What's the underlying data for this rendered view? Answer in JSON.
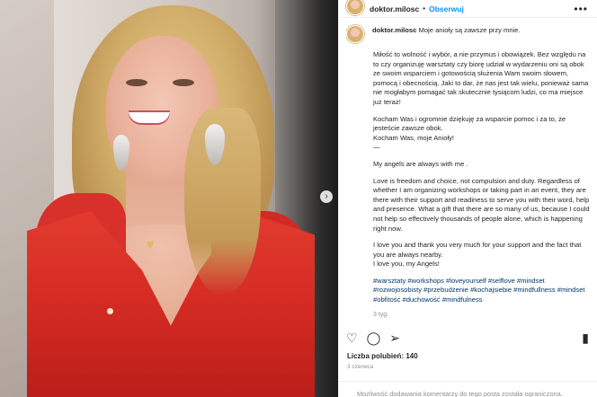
{
  "header": {
    "username": "doktor.milosc",
    "separator": "•",
    "follow_label": "Obserwuj",
    "more_icon": "more-horizontal-icon"
  },
  "caption": {
    "username": "doktor.milosc",
    "first_line": "Moje anioły są zawsze przy mnie.",
    "paragraph_pl_1": "Miłość to wolność i wybór, a nie przymus i obowiązek. Bez względu na to czy organizuję warsztaty czy biorę udział w wydarzeniu oni są obok ze swoim wsparciem i gotowością służenia Wam swoim słowem, pomocą i obecnością. Jaki to dar, że nas jest tak wielu, ponieważ sama nie mogłabym pomagać tak skutecznie tysiącom ludzi, co ma miejsce już teraz!",
    "paragraph_pl_2": "Kocham Was i ogromnie dziękuję za wsparcie pomoc i za to, że jesteście zawsze obok.",
    "paragraph_pl_3": "Kocham Was, moje Anioły!",
    "divider": "—",
    "en_title": "My angels are always with me .",
    "paragraph_en_1": "Love is freedom and choice, not compulsion and duty. Regardless of whether I am organizing workshops or taking part in an event, they are there with their support and readiness to serve you with their word, help and presence. What a gift that there are so many of us, because I could not help so effectively thousands of people alone, which is happening right now.",
    "paragraph_en_2": "I love you and thank you very much for your support and the fact that you are always nearby.",
    "paragraph_en_3": "I love you, my Angels!",
    "hashtags": "#warsztaty #workshops #loveyourself #selflove #mindset #rozwojosobisty #przebudzenie #kochajsiebie #mindfullness #mindset #obfitość #duchowość #mindfulness",
    "time_ago": "3 tyg."
  },
  "actions": {
    "like_icon": "heart-icon",
    "comment_icon": "comment-icon",
    "share_icon": "share-icon",
    "save_icon": "bookmark-icon"
  },
  "likes_label": "Liczba polubień: 140",
  "date": "3 czerwca",
  "comments_disabled": "Możliwość dodawania komentarzy do tego posta została ograniczona."
}
